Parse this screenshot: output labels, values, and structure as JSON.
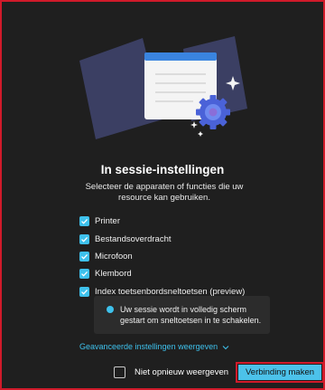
{
  "dialog": {
    "title": "In sessie-instellingen",
    "subtitle": "Selecteer de apparaten of functies die uw resource kan gebruiken."
  },
  "options": [
    {
      "label": "Printer",
      "checked": true
    },
    {
      "label": "Bestandsoverdracht",
      "checked": true
    },
    {
      "label": "Microfoon",
      "checked": true
    },
    {
      "label": "Klembord",
      "checked": true
    },
    {
      "label": "Index toetsenbordsneltoetsen (preview)",
      "checked": true
    }
  ],
  "info": {
    "text": "Uw sessie wordt in volledig scherm gestart om sneltoetsen in te schakelen."
  },
  "advanced": {
    "label": "Geavanceerde instellingen weergeven"
  },
  "footer": {
    "dont_show_label": "Niet opnieuw weergeven",
    "dont_show_checked": false,
    "connect_label": "Verbinding maken"
  },
  "colors": {
    "accent": "#3ec1ec",
    "background": "#1f1f1f",
    "highlight_border": "#d01a2a",
    "button": "#4cc2ea"
  },
  "icons": {
    "illustration": "window-with-gear-illustration",
    "checkbox": "checkmark-icon",
    "info": "info-dot-icon",
    "chevron": "chevron-down-icon"
  }
}
